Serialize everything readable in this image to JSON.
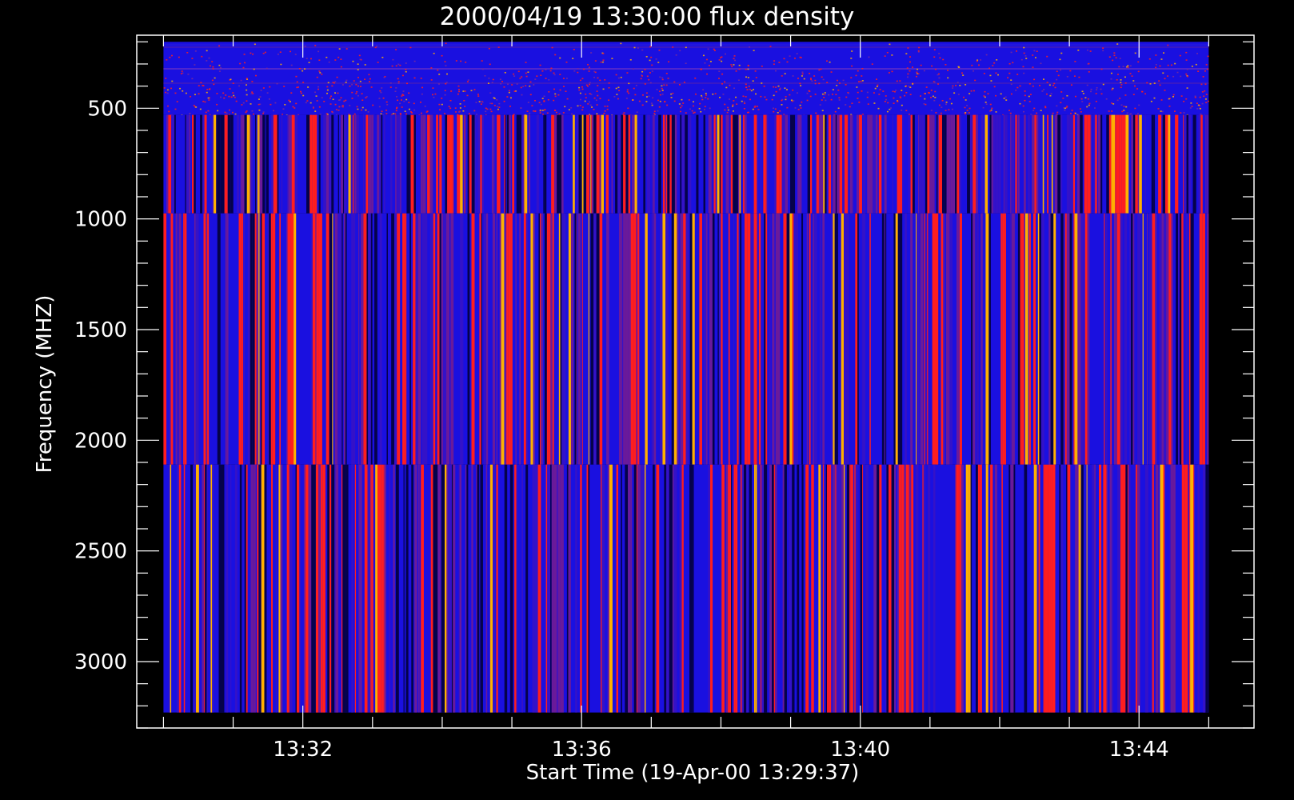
{
  "chart_data": {
    "type": "heatmap",
    "title": "2000/04/19 13:30:00 flux density",
    "xlabel": "Start Time (19-Apr-00 13:29:37)",
    "ylabel": "Frequency (MHZ)",
    "x_ticks": [
      "13:32",
      "13:36",
      "13:40",
      "13:44"
    ],
    "y_ticks": [
      500,
      1000,
      1500,
      2000,
      2500,
      3000
    ],
    "xlim": [
      "13:29:37",
      "13:45:39"
    ],
    "ylim": [
      3300,
      170
    ],
    "data_time_range": [
      "13:30:00",
      "13:45:00"
    ],
    "y_axis_inverted": true,
    "grid": false,
    "bands": [
      {
        "freq_range": [
          200,
          530
        ],
        "texture": "fine-noise"
      },
      {
        "freq_range": [
          530,
          975
        ],
        "texture": "vertical-stripes"
      },
      {
        "freq_range": [
          975,
          2110
        ],
        "texture": "vertical-stripes"
      },
      {
        "freq_range": [
          2110,
          3230
        ],
        "texture": "vertical-stripes"
      }
    ],
    "colors": {
      "background": "#000000",
      "axis": "#ffffff",
      "low": "#1a10e0",
      "mid": "#6a1a9a",
      "high": "#ff1e1e",
      "peak": "#ffb000"
    }
  }
}
